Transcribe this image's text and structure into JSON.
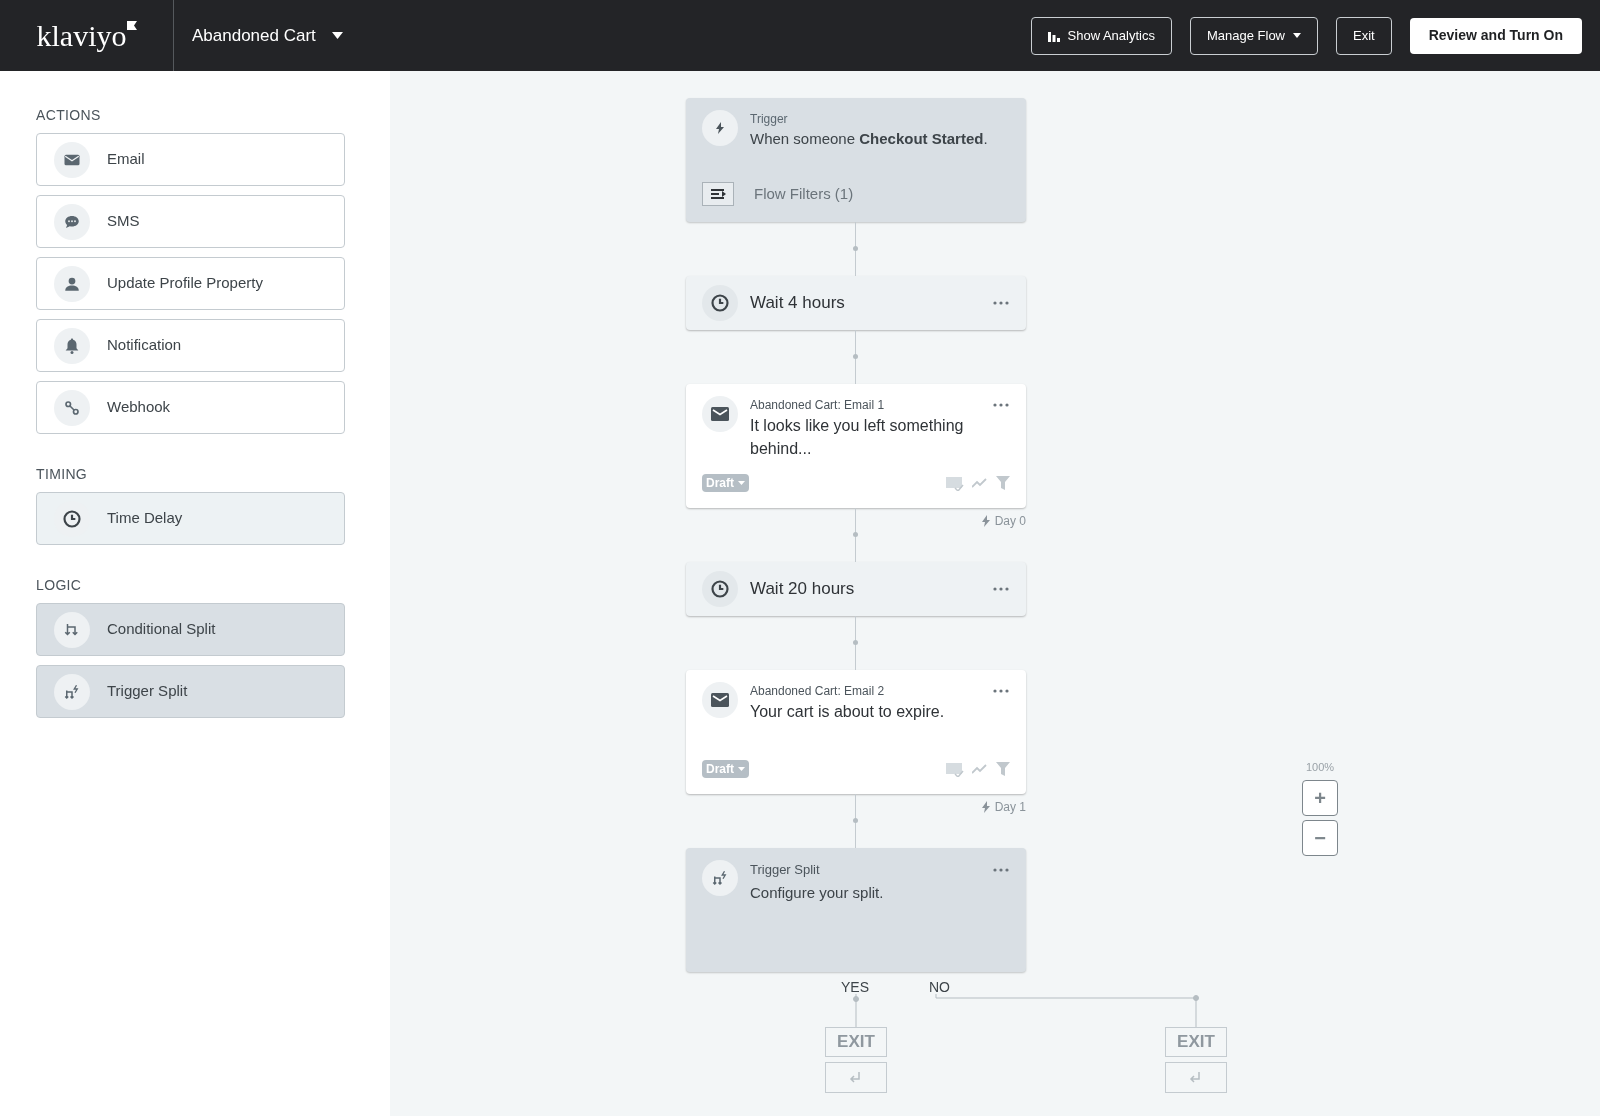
{
  "header": {
    "logo": "klaviyo",
    "flow_name": "Abandoned Cart",
    "buttons": [
      {
        "label": "Show Analytics",
        "kind": "analytics"
      },
      {
        "label": "Manage Flow",
        "kind": "dropdown"
      },
      {
        "label": "Exit",
        "kind": "plain"
      },
      {
        "label": "Review and Turn On",
        "kind": "primary"
      }
    ]
  },
  "sidebar": {
    "sections": [
      {
        "title": "ACTIONS",
        "kind": "action",
        "items": [
          {
            "label": "Email",
            "kind": "email"
          },
          {
            "label": "SMS",
            "kind": "sms"
          },
          {
            "label": "Update Profile Property",
            "kind": "profile"
          },
          {
            "label": "Notification",
            "kind": "notification"
          },
          {
            "label": "Webhook",
            "kind": "webhook"
          }
        ]
      },
      {
        "title": "TIMING",
        "kind": "timing",
        "items": [
          {
            "label": "Time Delay",
            "kind": "delay"
          }
        ]
      },
      {
        "title": "LOGIC",
        "kind": "logic",
        "items": [
          {
            "label": "Conditional Split",
            "kind": "conditional"
          },
          {
            "label": "Trigger Split",
            "kind": "trigger_split"
          }
        ]
      }
    ]
  },
  "flow": {
    "nodes": [
      {
        "kind": "trigger",
        "title": "Trigger",
        "text": "When someone **Checkout Started**.",
        "filter": "Flow Filters (1)"
      },
      {
        "kind": "delay",
        "text": "Wait 4 hours"
      },
      {
        "kind": "email",
        "title": "Abandoned Cart: Email 1",
        "text": "It looks like you left something behind...",
        "status": "Draft",
        "day": "Day 0"
      },
      {
        "kind": "delay",
        "text": "Wait 20 hours"
      },
      {
        "kind": "email",
        "title": "Abandoned Cart: Email 2",
        "text": "Your cart is about to expire.",
        "status": "Draft",
        "day": "Day 1"
      },
      {
        "kind": "split",
        "title": "Trigger Split",
        "text": "Configure your split.",
        "branches": [
          "YES",
          "NO"
        ],
        "exits": [
          "EXIT",
          "EXIT"
        ]
      }
    ]
  },
  "zoom": {
    "label": "100%",
    "buttons": [
      "+",
      "−"
    ]
  }
}
